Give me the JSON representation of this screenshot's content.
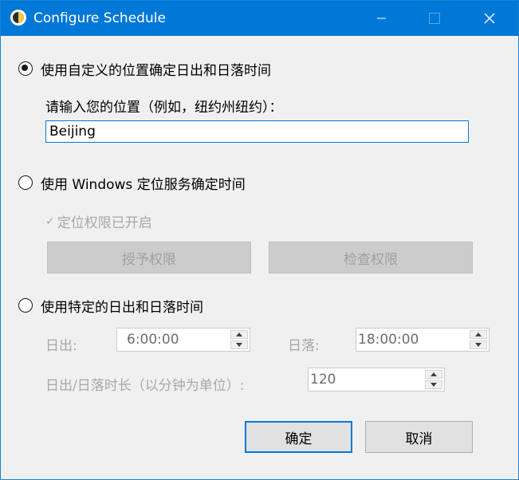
{
  "window": {
    "title": "Configure Schedule",
    "icon": "sun-moon-icon",
    "controls": [
      "minimize-icon",
      "maximize-icon",
      "close-icon"
    ]
  },
  "option_custom_location": {
    "label": "使用自定义的位置确定日出和日落时间",
    "selected": true,
    "prompt": "请输入您的位置（例如，纽约州纽约）：",
    "value": "Beijing"
  },
  "option_windows_location": {
    "label": "使用 Windows 定位服务确定时间",
    "selected": false,
    "permission_status": "定位权限已开启",
    "grant_button": "授予权限",
    "check_button": "检查权限"
  },
  "option_fixed_times": {
    "label": "使用特定的日出和日落时间",
    "selected": false,
    "sunrise_label": "日出:",
    "sunrise_value": "6:00:00",
    "sunset_label": "日落:",
    "sunset_value": "18:00:00",
    "duration_label": "日出/日落时长（以分钟为单位）:",
    "duration_value": "120"
  },
  "footer": {
    "ok_button": "确定",
    "cancel_button": "取消"
  },
  "colors": {
    "titlebar": "#0078d7",
    "background": "#f0f0f0",
    "accent": "#0078d7",
    "disabled_text": "#a8a8a8"
  }
}
